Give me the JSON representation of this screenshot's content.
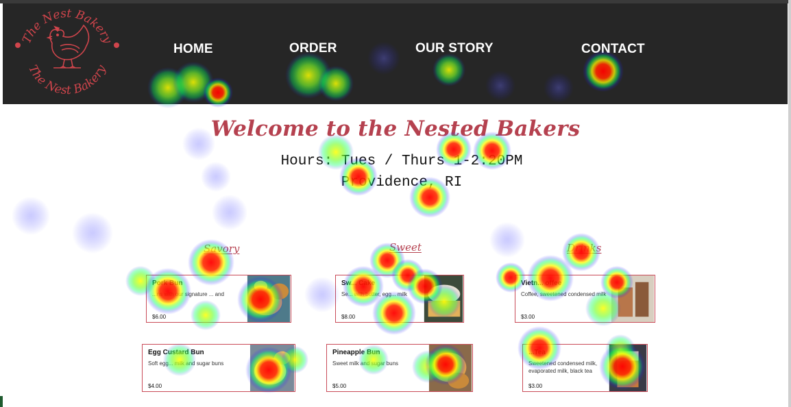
{
  "header": {
    "logo_text": "The Nest Bakery",
    "nav": [
      {
        "label": "HOME"
      },
      {
        "label": "ORDER"
      },
      {
        "label": "OUR STORY"
      },
      {
        "label": "CONTACT"
      }
    ]
  },
  "main": {
    "title": "Welcome to the Nested Bakers",
    "hours": "Hours: Tues / Thurs 1-2:20PM",
    "location": "Providence, RI"
  },
  "menu": {
    "categories": [
      {
        "label": "Savory"
      },
      {
        "label": "Sweet"
      },
      {
        "label": "Drinks"
      }
    ],
    "items": [
      {
        "name": "Pork Bun",
        "description": "...ns with our signature ... and",
        "price": "$6.00"
      },
      {
        "name": "Sw... Cake",
        "description": "Se... with butter, egg... milk",
        "price": "$8.00"
      },
      {
        "name": "Vietn... offee",
        "description": "Coffee, sweetened condensed milk",
        "price": "$3.00"
      },
      {
        "name": "Egg Custard Bun",
        "description": "Soft egg... milk and sugar buns",
        "price": "$4.00"
      },
      {
        "name": "Pineapple Bun",
        "description": "Sweet milk and sugar buns",
        "price": "$5.00"
      },
      {
        "name": "...Tea",
        "description": "Sweetened condensed milk, evaporated milk, black tea",
        "price": "$3.00"
      }
    ]
  },
  "colors": {
    "accent": "#b5414f",
    "header_bg": "#262626",
    "card_border": "#c94a57"
  },
  "heatmap_colors": [
    "#2222ff",
    "#00ff66",
    "#ffff00",
    "#ff0000"
  ]
}
